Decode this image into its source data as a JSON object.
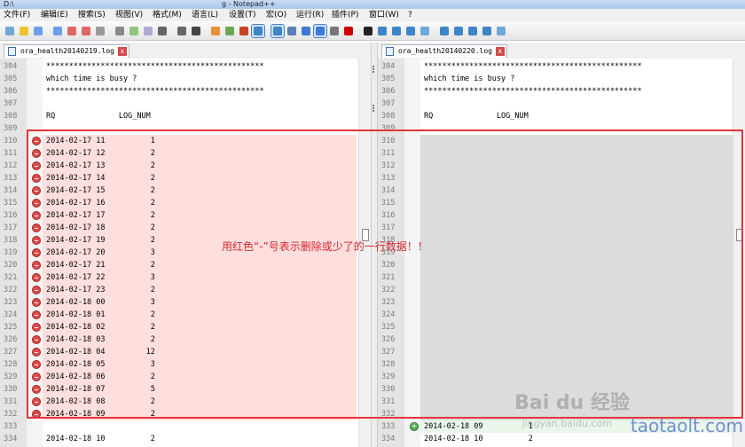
{
  "window": {
    "title_left": "D:\\",
    "title_center": "g - Notepad++"
  },
  "menu": [
    "文件(F)",
    "编辑(E)",
    "搜索(S)",
    "视图(V)",
    "格式(M)",
    "语言(L)",
    "设置(T)",
    "宏(O)",
    "运行(R)",
    "插件(P)",
    "窗口(W)",
    "?"
  ],
  "toolbar_icons": [
    "new-file-icon",
    "open-file-icon",
    "save-icon",
    "save-all-icon",
    "close-icon",
    "close-all-icon",
    "print-icon",
    "cut-icon",
    "copy-icon",
    "paste-icon",
    "undo-icon",
    "redo-icon",
    "find-icon",
    "replace-icon",
    "zoom-in-icon",
    "zoom-out-icon",
    "sync-vertical-icon",
    "sync-horizontal-icon",
    "word-wrap-icon",
    "show-all-chars-icon",
    "indent-guide-icon",
    "doc-map-icon",
    "record-macro-icon",
    "stop-record-icon",
    "play-macro-icon",
    "run-macro-multiple-icon",
    "save-macro-icon",
    "compare-icon",
    "prev-diff-icon",
    "next-diff-icon",
    "first-diff-icon",
    "last-diff-icon",
    "spell-check-icon"
  ],
  "left_tab": {
    "label": "ora_health20140219.log"
  },
  "right_tab": {
    "label": "ora_health20140220.log"
  },
  "left_lines": [
    {
      "n": "304",
      "t": "************************************************",
      "kind": "normal"
    },
    {
      "n": "305",
      "t": "which time is busy ?",
      "kind": "normal"
    },
    {
      "n": "306",
      "t": "************************************************",
      "kind": "normal"
    },
    {
      "n": "307",
      "t": "",
      "kind": "normal"
    },
    {
      "n": "308",
      "t": "RQ              LOG_NUM",
      "kind": "normal"
    },
    {
      "n": "309",
      "t": "",
      "kind": "normal"
    },
    {
      "n": "310",
      "t": "2014-02-17 11          1",
      "kind": "del"
    },
    {
      "n": "311",
      "t": "2014-02-17 12          2",
      "kind": "del"
    },
    {
      "n": "312",
      "t": "2014-02-17 13          2",
      "kind": "del"
    },
    {
      "n": "313",
      "t": "2014-02-17 14          2",
      "kind": "del"
    },
    {
      "n": "314",
      "t": "2014-02-17 15          2",
      "kind": "del"
    },
    {
      "n": "315",
      "t": "2014-02-17 16          2",
      "kind": "del"
    },
    {
      "n": "316",
      "t": "2014-02-17 17          2",
      "kind": "del"
    },
    {
      "n": "317",
      "t": "2014-02-17 18          2",
      "kind": "del"
    },
    {
      "n": "318",
      "t": "2014-02-17 19          2",
      "kind": "del"
    },
    {
      "n": "319",
      "t": "2014-02-17 20          3",
      "kind": "del"
    },
    {
      "n": "320",
      "t": "2014-02-17 21          2",
      "kind": "del"
    },
    {
      "n": "321",
      "t": "2014-02-17 22          3",
      "kind": "del"
    },
    {
      "n": "322",
      "t": "2014-02-17 23          2",
      "kind": "del"
    },
    {
      "n": "323",
      "t": "2014-02-18 00          3",
      "kind": "del"
    },
    {
      "n": "324",
      "t": "2014-02-18 01          2",
      "kind": "del"
    },
    {
      "n": "325",
      "t": "2014-02-18 02          2",
      "kind": "del"
    },
    {
      "n": "326",
      "t": "2014-02-18 03          2",
      "kind": "del"
    },
    {
      "n": "327",
      "t": "2014-02-18 04         12",
      "kind": "del"
    },
    {
      "n": "328",
      "t": "2014-02-18 05          3",
      "kind": "del"
    },
    {
      "n": "329",
      "t": "2014-02-18 06          2",
      "kind": "del"
    },
    {
      "n": "330",
      "t": "2014-02-18 07          5",
      "kind": "del"
    },
    {
      "n": "331",
      "t": "2014-02-18 08          2",
      "kind": "del"
    },
    {
      "n": "332",
      "t": "2014-02-18 09          2",
      "kind": "del"
    },
    {
      "n": "333",
      "t": "",
      "kind": "normal"
    },
    {
      "n": "334",
      "t": "2014-02-18 10          2",
      "kind": "normal"
    }
  ],
  "right_lines": [
    {
      "n": "304",
      "t": "************************************************",
      "kind": "normal"
    },
    {
      "n": "305",
      "t": "which time is busy ?",
      "kind": "normal"
    },
    {
      "n": "306",
      "t": "************************************************",
      "kind": "normal"
    },
    {
      "n": "307",
      "t": "",
      "kind": "normal"
    },
    {
      "n": "308",
      "t": "RQ              LOG_NUM",
      "kind": "normal"
    },
    {
      "n": "309",
      "t": "",
      "kind": "normal"
    },
    {
      "n": "310",
      "t": "",
      "kind": "blank"
    },
    {
      "n": "311",
      "t": "",
      "kind": "blank"
    },
    {
      "n": "312",
      "t": "",
      "kind": "blank"
    },
    {
      "n": "313",
      "t": "",
      "kind": "blank"
    },
    {
      "n": "314",
      "t": "",
      "kind": "blank"
    },
    {
      "n": "315",
      "t": "",
      "kind": "blank"
    },
    {
      "n": "316",
      "t": "",
      "kind": "blank"
    },
    {
      "n": "317",
      "t": "",
      "kind": "blank"
    },
    {
      "n": "318",
      "t": "",
      "kind": "blank"
    },
    {
      "n": "319",
      "t": "",
      "kind": "blank"
    },
    {
      "n": "320",
      "t": "",
      "kind": "blank"
    },
    {
      "n": "321",
      "t": "",
      "kind": "blank"
    },
    {
      "n": "322",
      "t": "",
      "kind": "blank"
    },
    {
      "n": "323",
      "t": "",
      "kind": "blank"
    },
    {
      "n": "324",
      "t": "",
      "kind": "blank"
    },
    {
      "n": "325",
      "t": "",
      "kind": "blank"
    },
    {
      "n": "326",
      "t": "",
      "kind": "blank"
    },
    {
      "n": "327",
      "t": "",
      "kind": "blank"
    },
    {
      "n": "328",
      "t": "",
      "kind": "blank"
    },
    {
      "n": "329",
      "t": "",
      "kind": "blank"
    },
    {
      "n": "330",
      "t": "",
      "kind": "blank"
    },
    {
      "n": "331",
      "t": "",
      "kind": "blank"
    },
    {
      "n": "332",
      "t": "",
      "kind": "blank"
    },
    {
      "n": "333",
      "t": "2014-02-18 09          1",
      "kind": "add"
    },
    {
      "n": "334",
      "t": "2014-02-18 10          2",
      "kind": "normal"
    }
  ],
  "annotation": {
    "text": "用红色“-”号表示删除或少了的一行数据！！",
    "color": "#e8343a"
  },
  "watermark": {
    "baidu": "Bai du 经验",
    "jingyan": "jingyan.baidu.com",
    "site": "taotaolt.com"
  },
  "colors": {
    "deleted_bg": "#ffdede",
    "blank_bg": "#dcdcdc",
    "added_marker": "#4caa4c",
    "deleted_marker": "#e24a4a"
  }
}
